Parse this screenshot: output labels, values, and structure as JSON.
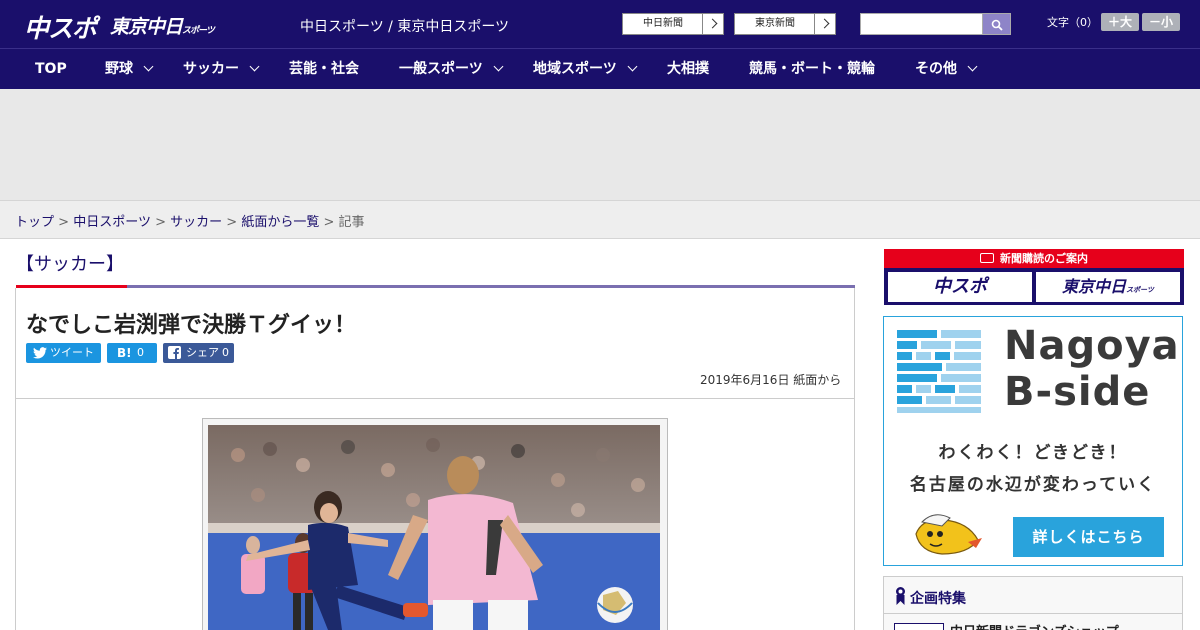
{
  "header": {
    "logo_main": "中スポ",
    "logo_sub": "東京中日",
    "logo_sub_small": "スポーツ",
    "site_title": "中日スポーツ / 東京中日スポーツ",
    "ext_links": [
      "中日新聞",
      "東京新聞"
    ],
    "search": {
      "placeholder": "",
      "icon": "search-icon"
    },
    "font_size_label": "文字（0）",
    "font_bigger": "＋大",
    "font_smaller": "－小"
  },
  "nav": [
    {
      "label": "TOP",
      "has_menu": false
    },
    {
      "label": "野球",
      "has_menu": true
    },
    {
      "label": "サッカー",
      "has_menu": true
    },
    {
      "label": "芸能・社会",
      "has_menu": false
    },
    {
      "label": "一般スポーツ",
      "has_menu": true
    },
    {
      "label": "地域スポーツ",
      "has_menu": true
    },
    {
      "label": "大相撲",
      "has_menu": false
    },
    {
      "label": "競馬・ボート・競輪",
      "has_menu": false
    },
    {
      "label": "その他",
      "has_menu": true
    }
  ],
  "breadcrumb": {
    "items": [
      "トップ",
      "中日スポーツ",
      "サッカー",
      "紙面から一覧"
    ],
    "separator": ">",
    "current": "記事"
  },
  "article": {
    "category": "【サッカー】",
    "headline": "なでしこ岩渕弾で決勝Ｔグイッ！",
    "share": {
      "tweet_label": "ツイート",
      "hatena_label": "B!",
      "hatena_count": "0",
      "facebook_label": "シェア",
      "facebook_count": "0"
    },
    "date": "2019年6月16日 紙面から"
  },
  "sidebar": {
    "subscription": {
      "header": "新聞購読のご案内",
      "logo_a": "中スポ",
      "logo_b": "東京中日",
      "logo_b_small": "スポーツ"
    },
    "bside": {
      "title_line1": "Nagoya",
      "title_line2": "B-side",
      "copy_line1": "わくわく！どきどき！",
      "copy_line2": "名古屋の水辺が変わっていく",
      "button": "詳しくはこちら"
    },
    "feature": {
      "header": "企画特集",
      "first_item": "中日新聞ドラゴンズショップ"
    }
  },
  "colors": {
    "brand_navy": "#1a0f6b",
    "accent_red": "#e6001b",
    "twitter_blue": "#1b95e0",
    "facebook_blue": "#3b5998",
    "bside_blue": "#29a3dc"
  }
}
